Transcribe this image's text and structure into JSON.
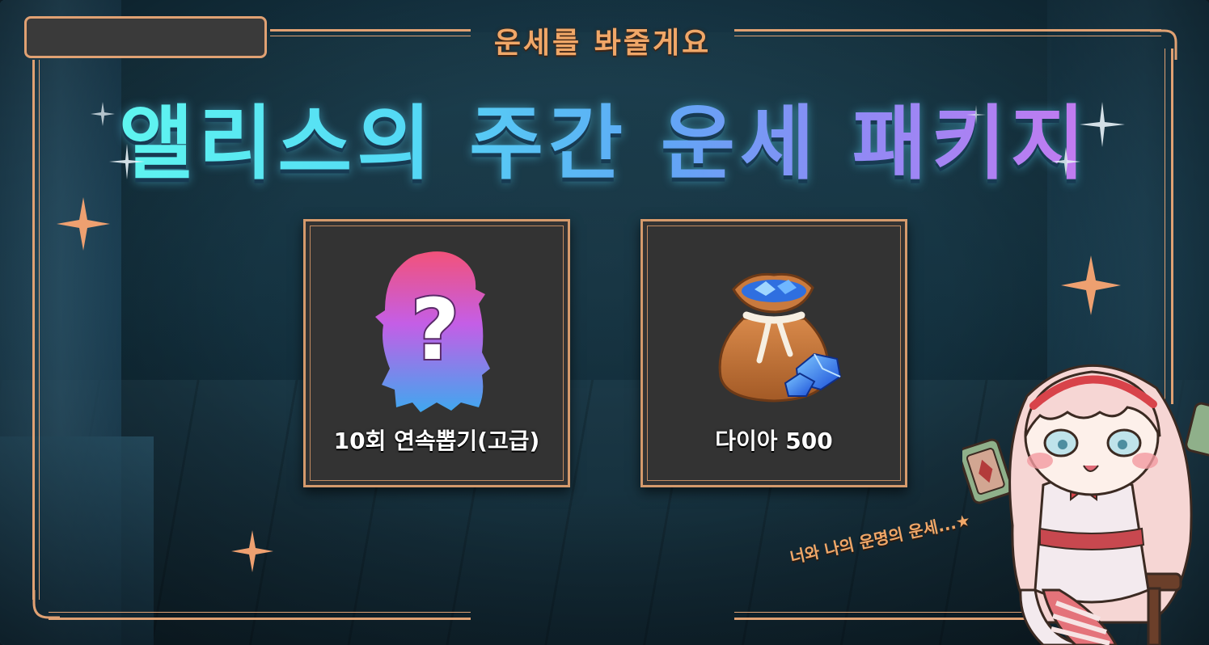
{
  "banner": {
    "subtitle": "운세를 봐줄게요",
    "title": "앨리스의 주간 운세 패키지",
    "tagline": "너와 나의 운명의 운세...★"
  },
  "rewards": [
    {
      "label": "10회 연속뽑기(고급)",
      "icon": "mystery-silhouette-icon"
    },
    {
      "label": "다이아 500",
      "icon": "diamond-bag-icon"
    }
  ],
  "colors": {
    "frame": "#e0a173",
    "subtitle": "#f0a768",
    "card_bg": "#333333",
    "title_gradient_start": "#5ff6f0",
    "title_gradient_end": "#c57af0"
  }
}
